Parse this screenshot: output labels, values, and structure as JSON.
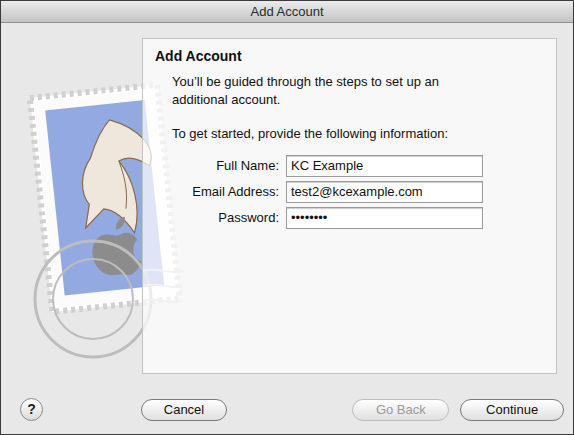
{
  "window": {
    "title": "Add Account"
  },
  "panel": {
    "heading": "Add Account",
    "intro": "You’ll be guided through the steps to set up an additional account.",
    "prompt": "To get started, provide the following information:"
  },
  "fields": [
    {
      "label": "Full Name:",
      "value": "KC Example"
    },
    {
      "label": "Email Address:",
      "value": "test2@kcexample.com"
    },
    {
      "label": "Password:",
      "value": "••••••••"
    }
  ],
  "help": "?",
  "buttons": [
    {
      "label": "Cancel",
      "disabled": false
    },
    {
      "label": "Go Back",
      "disabled": true
    },
    {
      "label": "Continue",
      "disabled": false
    }
  ]
}
